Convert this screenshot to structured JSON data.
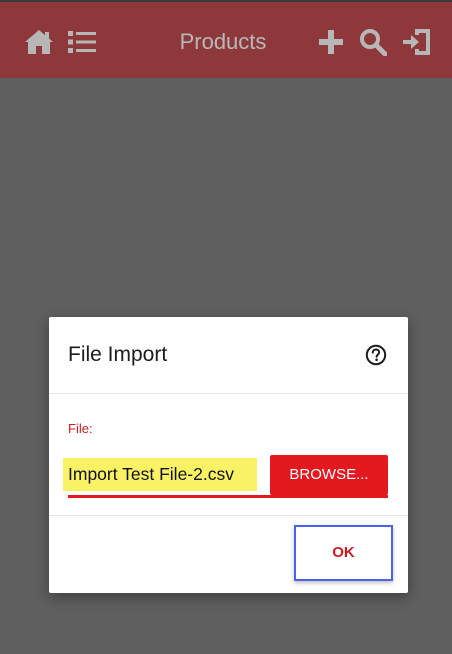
{
  "appbar": {
    "title": "Products",
    "icons": [
      "home-icon",
      "list-icon",
      "plus-icon",
      "search-icon",
      "import-icon"
    ],
    "background_color": "#b51a1f"
  },
  "dialog": {
    "title": "File Import",
    "help_icon": "help-circle-icon",
    "file_label": "File:",
    "file_value": "Import Test File-2.csv",
    "browse_label": "BROWSE...",
    "ok_label": "OK",
    "accent_color": "#e3191f",
    "highlight_color": "#f8f264",
    "focus_outline_color": "#4a63e8"
  }
}
